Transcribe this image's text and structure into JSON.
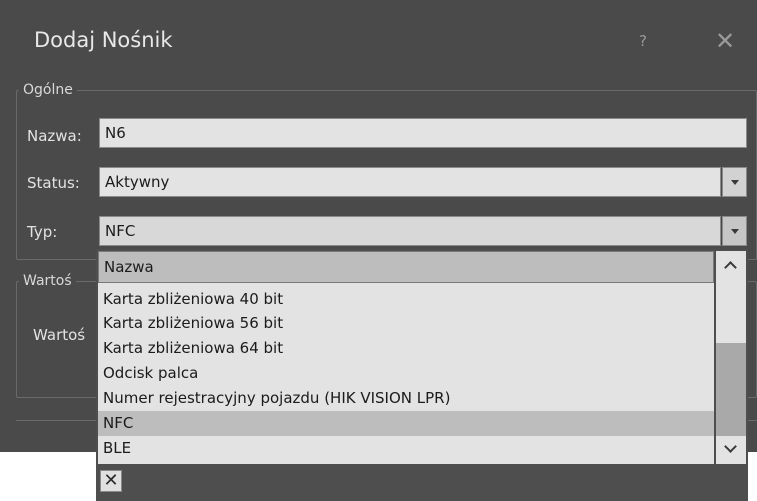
{
  "dialog": {
    "title": "Dodaj Nośnik",
    "help_label": "?",
    "close_label": "✕"
  },
  "general": {
    "legend": "Ogólne",
    "name_label": "Nazwa:",
    "name_value": "N6",
    "status_label": "Status:",
    "status_value": "Aktywny",
    "type_label": "Typ:",
    "type_value": "NFC"
  },
  "value_group": {
    "legend": "Wartoś",
    "value_label": "Wartoś"
  },
  "dropdown": {
    "header": "Nazwa",
    "items": [
      "Karta zbliżeniowa 40 bit",
      "Karta zbliżeniowa 56 bit",
      "Karta zbliżeniowa 64 bit",
      "Odcisk palca",
      "Numer rejestracyjny pojazdu (HIK VISION LPR)",
      "NFC",
      "BLE"
    ],
    "selected": "NFC",
    "clear_label": "✕"
  },
  "colors": {
    "dialog_bg": "#4a4a4a",
    "field_bg": "#e3e3e3",
    "selected_bg": "#bdbdbd"
  }
}
